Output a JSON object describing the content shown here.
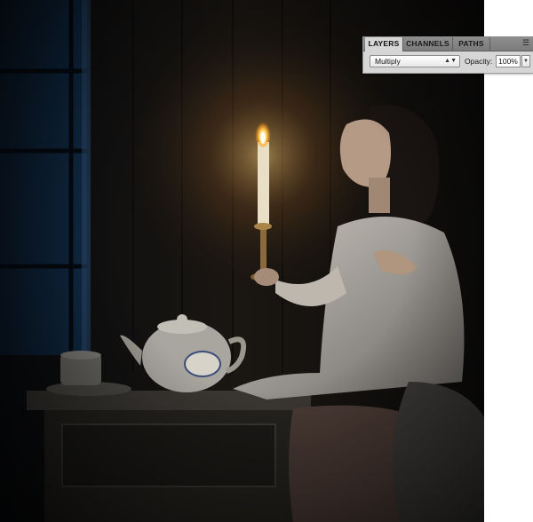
{
  "panel": {
    "tabs": [
      {
        "label": "LAYERS",
        "active": true
      },
      {
        "label": "CHANNELS",
        "active": false
      },
      {
        "label": "PATHS",
        "active": false
      }
    ],
    "menu_icon": "panel-menu-icon",
    "blend_mode": "Multiply",
    "opacity_label": "Opacity:",
    "opacity_value": "100%"
  },
  "colors": {
    "panel_bg": "#d6d6d6",
    "tab_bar": "#858585",
    "canvas_bg": "#06080b",
    "candle_glow": "#ffb347"
  }
}
